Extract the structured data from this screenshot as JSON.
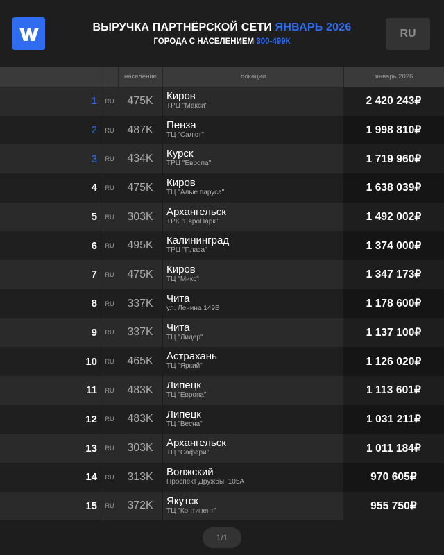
{
  "header": {
    "title_main": "ВЫРУЧКА ПАРТНЁРСКОЙ СЕТИ",
    "title_accent": "ЯНВАРЬ 2026",
    "subtitle_main": "ГОРОДА С НАСЕЛЕНИЕМ",
    "subtitle_accent": "300-499К",
    "lang_button": "RU",
    "logo_letter": "W"
  },
  "colors": {
    "accent": "#2f6cf0",
    "background": "#1d1d1d"
  },
  "table": {
    "columns": {
      "population": "население",
      "location": "локации",
      "revenue": "январь 2026"
    },
    "rows": [
      {
        "rank": "1",
        "country": "RU",
        "population": "475K",
        "city": "Киров",
        "venue": "ТРЦ \"Макси\"",
        "revenue": "2 420 243₽"
      },
      {
        "rank": "2",
        "country": "RU",
        "population": "487K",
        "city": "Пенза",
        "venue": "ТЦ \"Салют\"",
        "revenue": "1 998 810₽"
      },
      {
        "rank": "3",
        "country": "RU",
        "population": "434K",
        "city": "Курск",
        "venue": "ТРЦ \"Европа\"",
        "revenue": "1 719 960₽"
      },
      {
        "rank": "4",
        "country": "RU",
        "population": "475K",
        "city": "Киров",
        "venue": "ТЦ \"Алые паруса\"",
        "revenue": "1 638 039₽"
      },
      {
        "rank": "5",
        "country": "RU",
        "population": "303K",
        "city": "Архангельск",
        "venue": "ТРК \"ЕвроПарк\"",
        "revenue": "1 492 002₽"
      },
      {
        "rank": "6",
        "country": "RU",
        "population": "495K",
        "city": "Калининград",
        "venue": "ТРЦ \"Плаза\"",
        "revenue": "1 374 000₽"
      },
      {
        "rank": "7",
        "country": "RU",
        "population": "475K",
        "city": "Киров",
        "venue": "ТЦ \"Микс\"",
        "revenue": "1 347 173₽"
      },
      {
        "rank": "8",
        "country": "RU",
        "population": "337K",
        "city": "Чита",
        "venue": "ул. Ленина 149В",
        "revenue": "1 178 600₽"
      },
      {
        "rank": "9",
        "country": "RU",
        "population": "337K",
        "city": "Чита",
        "venue": "ТЦ \"Лидер\"",
        "revenue": "1 137 100₽"
      },
      {
        "rank": "10",
        "country": "RU",
        "population": "465K",
        "city": "Астрахань",
        "venue": "ТЦ \"Яркий\"",
        "revenue": "1 126 020₽"
      },
      {
        "rank": "11",
        "country": "RU",
        "population": "483K",
        "city": "Липецк",
        "venue": "ТЦ \"Европа\"",
        "revenue": "1 113 601₽"
      },
      {
        "rank": "12",
        "country": "RU",
        "population": "483K",
        "city": "Липецк",
        "venue": "ТЦ \"Весна\"",
        "revenue": "1 031 211₽"
      },
      {
        "rank": "13",
        "country": "RU",
        "population": "303K",
        "city": "Архангельск",
        "venue": "ТЦ \"Сафари\"",
        "revenue": "1 011 184₽"
      },
      {
        "rank": "14",
        "country": "RU",
        "population": "313K",
        "city": "Волжский",
        "venue": "Проспект Дружбы, 105А",
        "revenue": "970 605₽"
      },
      {
        "rank": "15",
        "country": "RU",
        "population": "372K",
        "city": "Якутск",
        "venue": "ТЦ \"Континент\"",
        "revenue": "955 750₽"
      }
    ]
  },
  "pager": {
    "label": "1/1"
  }
}
